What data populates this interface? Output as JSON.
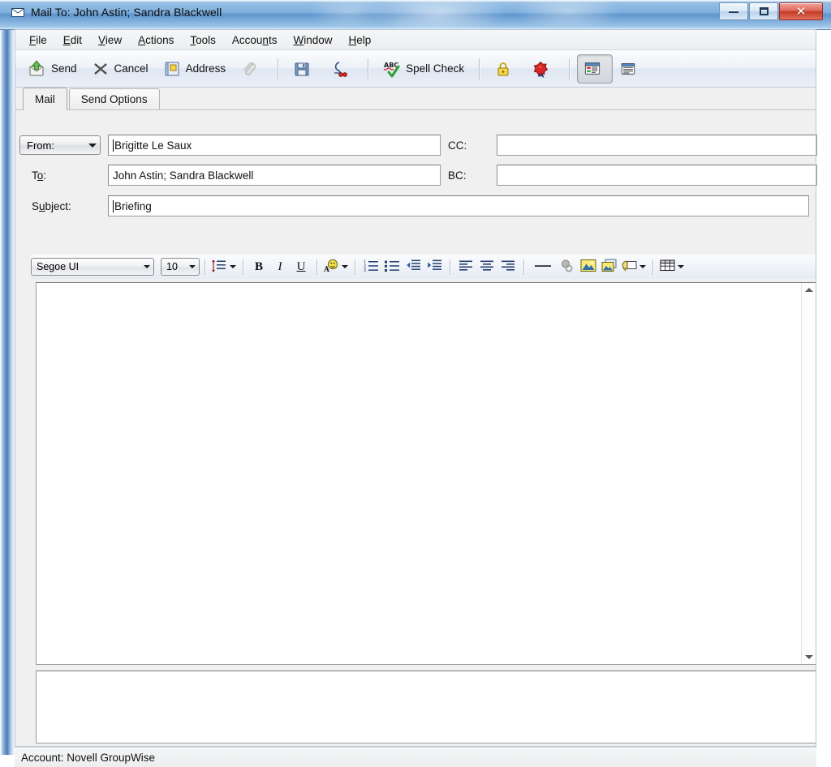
{
  "window": {
    "title": "Mail To: John Astin; Sandra Blackwell",
    "icon": "envelope-icon",
    "buttons": {
      "minimize": "Minimize",
      "maximize": "Maximize",
      "close": "✕"
    }
  },
  "menubar": {
    "items": [
      {
        "label": "File",
        "accel": "F"
      },
      {
        "label": "Edit",
        "accel": "E"
      },
      {
        "label": "View",
        "accel": "V"
      },
      {
        "label": "Actions",
        "accel": "A"
      },
      {
        "label": "Tools",
        "accel": "T"
      },
      {
        "label": "Accounts",
        "accel": "n"
      },
      {
        "label": "Window",
        "accel": "W"
      },
      {
        "label": "Help",
        "accel": "H"
      }
    ]
  },
  "toolbar": {
    "send_label": "Send",
    "cancel_label": "Cancel",
    "address_label": "Address",
    "attach_label": "",
    "save_label": "",
    "signature_label": "",
    "spellcheck_label": "Spell Check",
    "encrypt_label": "",
    "sign_label": "",
    "view_html_label": "",
    "view_plain_label": "",
    "icons": {
      "send": "send-mail-icon",
      "cancel": "cancel-icon",
      "address": "address-book-icon",
      "attach": "paperclip-icon",
      "save": "floppy-save-icon",
      "signature": "signature-icon",
      "spellcheck": "abc-spell-check-icon",
      "encrypt": "padlock-icon",
      "sign": "wax-seal-icon",
      "view_html": "html-view-icon",
      "view_plain": "plain-view-icon"
    }
  },
  "tabs": [
    {
      "label": "Mail",
      "active": true
    },
    {
      "label": "Send Options",
      "active": false
    }
  ],
  "form": {
    "from_combo": "From:",
    "from_value": "Brigitte Le Saux",
    "to_label": "To:",
    "to_label_accel": "o",
    "to_value": "John Astin; Sandra Blackwell",
    "subject_label": "Subject:",
    "subject_label_accel": "u",
    "subject_value": "Briefing",
    "cc_label": "CC:",
    "cc_value": "",
    "bc_label": "BC:",
    "bc_value": ""
  },
  "format_toolbar": {
    "font_family": "Segoe UI",
    "font_size": "10",
    "bold": "B",
    "italic": "I",
    "underline": "U",
    "icons": {
      "line_spacing": "line-spacing-icon",
      "font_color": "font-color-icon",
      "numbered_list": "numbered-list-icon",
      "bulleted_list": "bulleted-list-icon",
      "decrease_indent": "decrease-indent-icon",
      "increase_indent": "increase-indent-icon",
      "align_left": "align-left-icon",
      "align_center": "align-center-icon",
      "align_right": "align-right-icon",
      "horizontal_line": "horizontal-line-icon",
      "link": "link-icon",
      "insert_image": "insert-image-icon",
      "image_properties": "image-properties-icon",
      "text_wrap": "text-wrap-icon",
      "table": "table-icon"
    }
  },
  "body": {
    "content": "",
    "scrollbar": {
      "up": "scroll-up-arrow",
      "down": "scroll-down-arrow"
    }
  },
  "attachments": {
    "items": []
  },
  "statusbar": {
    "text": "Account: Novell GroupWise"
  },
  "colors": {
    "title_bar_blue": "#7fb0dd",
    "frame_blue": "#4a7fb5",
    "close_red": "#c33a26",
    "toolbar_bg": "#eef2f8",
    "client_bg": "#f0f0f0",
    "field_bg": "#ffffff"
  }
}
